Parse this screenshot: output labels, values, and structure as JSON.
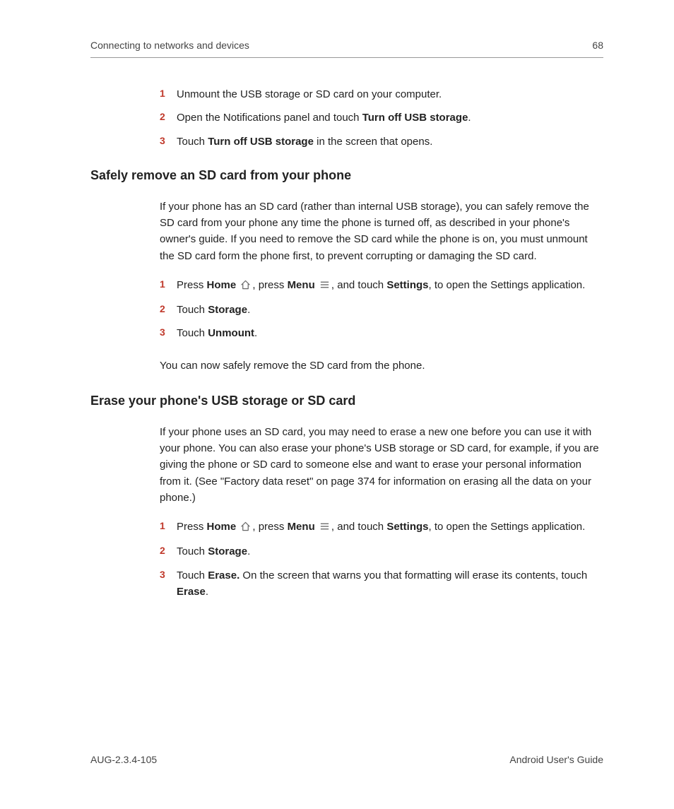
{
  "header": {
    "chapter": "Connecting to networks and devices",
    "page": "68"
  },
  "top_list": {
    "items": [
      {
        "num": "1",
        "html": "Unmount the USB storage or SD card on your computer."
      },
      {
        "num": "2",
        "html": "Open the Notifications panel and touch <strong>Turn off USB storage</strong>."
      },
      {
        "num": "3",
        "html": "Touch <strong>Turn off USB storage</strong> in the screen that opens."
      }
    ]
  },
  "section1": {
    "heading": "Safely remove an SD card from your phone",
    "para": "If your phone has an SD card (rather than internal USB storage), you can safely remove the SD card from your phone any time the phone is turned off, as described in your phone's owner's guide. If you need to remove the SD card while the phone is on, you must unmount the SD card form the phone first, to prevent corrupting or damaging the SD card.",
    "items": [
      {
        "num": "1",
        "html": "Press <strong>Home</strong> {home}, press <strong>Menu</strong> {menu}, and touch <strong>Settings</strong>, to open the Settings application."
      },
      {
        "num": "2",
        "html": "Touch <strong>Storage</strong>."
      },
      {
        "num": "3",
        "html": "Touch <strong>Unmount</strong>."
      }
    ],
    "after": "You can now safely remove the SD card from the phone."
  },
  "section2": {
    "heading": "Erase your phone's USB storage or SD card",
    "para": "If your phone uses an SD card, you may need to erase a new one before you can use it with your phone. You can also erase your phone's USB storage or SD card, for example, if you are giving the phone or SD card to someone else and want to erase your personal information from it. (See \"Factory data reset\" on page 374 for information on erasing all the data on your phone.)",
    "items": [
      {
        "num": "1",
        "html": "Press <strong>Home</strong> {home}, press <strong>Menu</strong> {menu}, and touch <strong>Settings</strong>, to open the Settings application."
      },
      {
        "num": "2",
        "html": "Touch <strong>Storage</strong>."
      },
      {
        "num": "3",
        "html": "Touch <strong>Erase.</strong> On the screen that warns you that formatting will erase its contents, touch <strong>Erase</strong>."
      }
    ]
  },
  "footer": {
    "left": "AUG-2.3.4-105",
    "right": "Android User's Guide"
  },
  "icons": {
    "home": "home-icon",
    "menu": "menu-icon"
  }
}
